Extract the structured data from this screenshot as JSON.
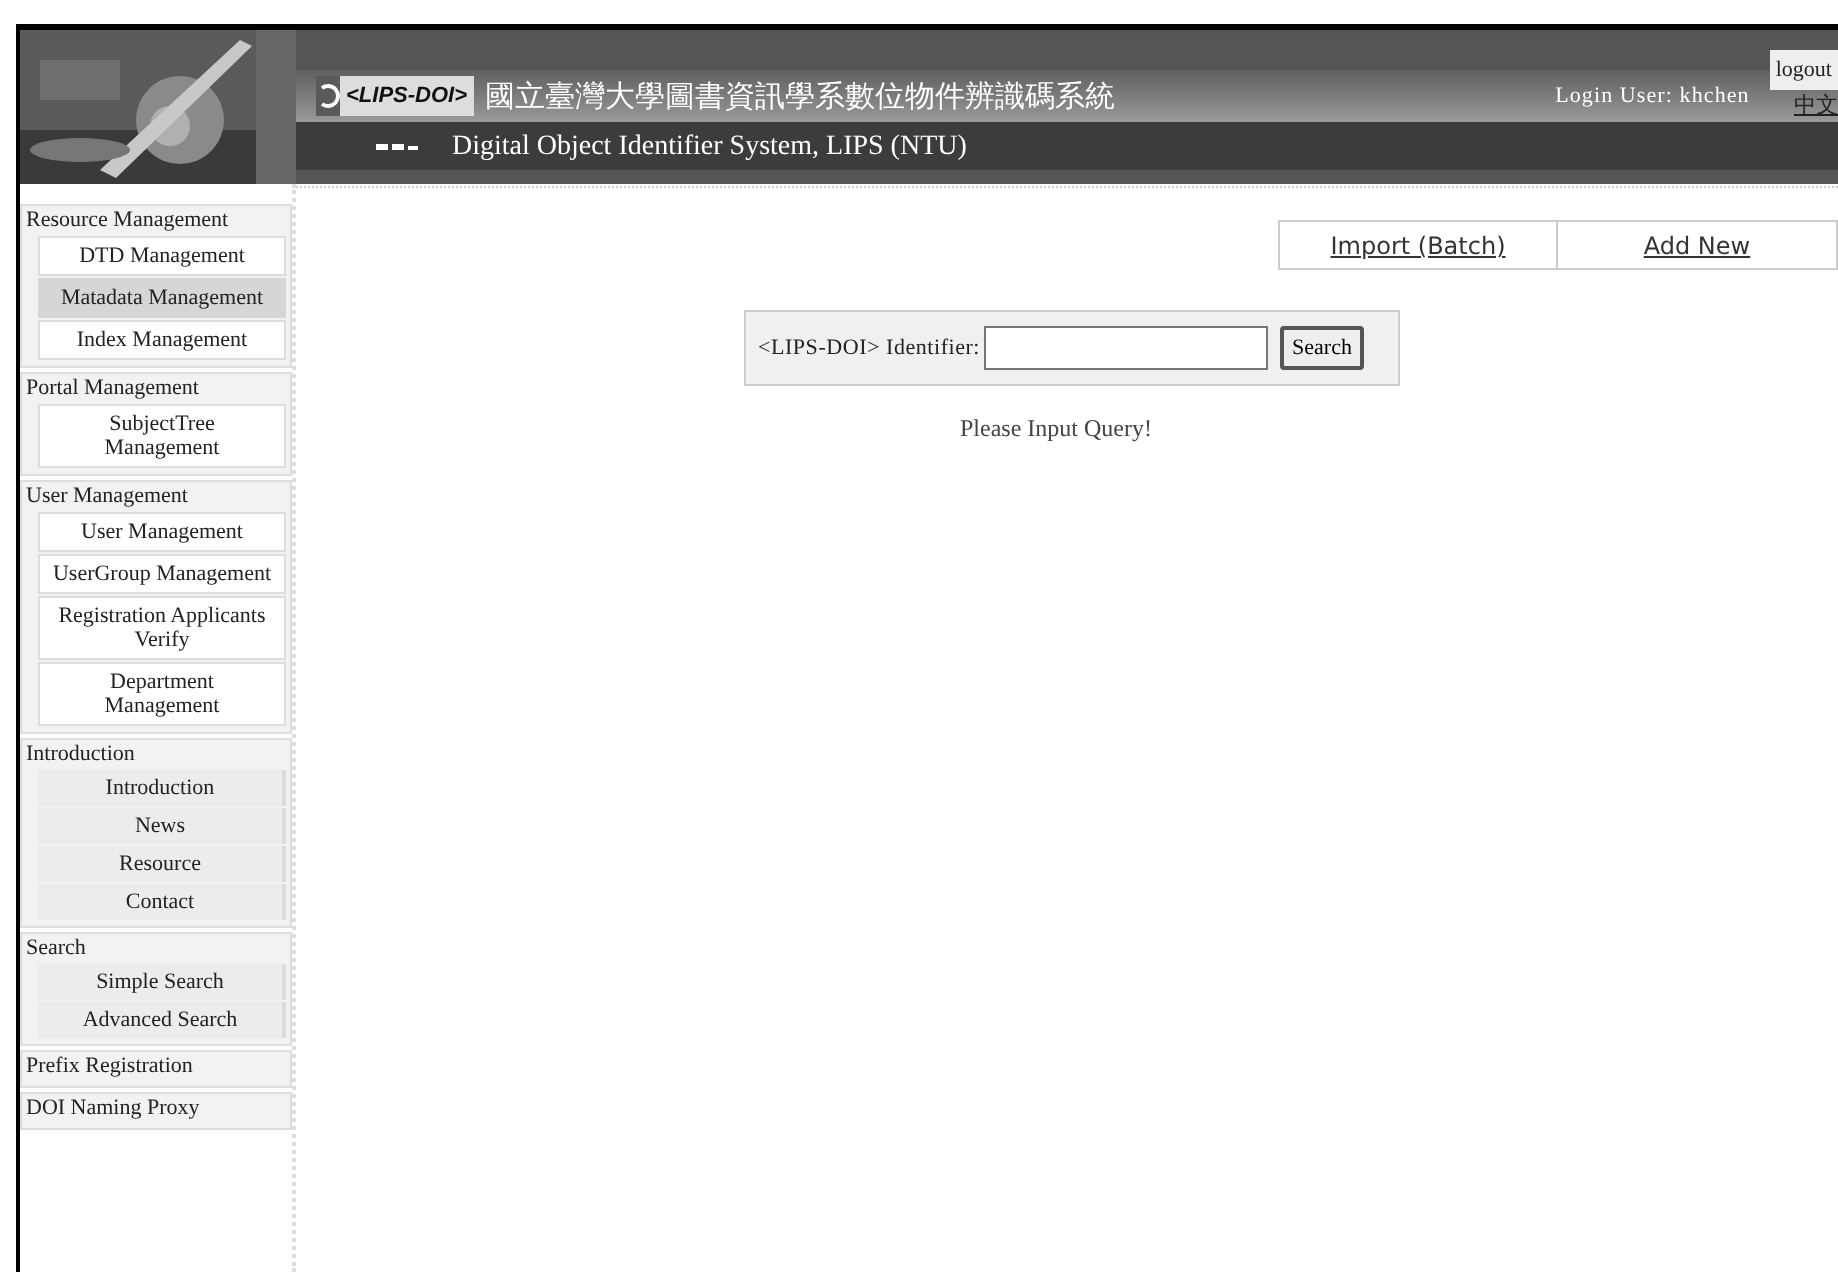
{
  "header": {
    "logo": "<LIPS-DOI>",
    "title_zh": "國立臺灣大學圖書資訊學系數位物件辨識碼系統",
    "title_en": "Digital Object Identifier System, LIPS (NTU)",
    "login_user": "Login User: khchen",
    "logout": "logout",
    "language_link": "中文"
  },
  "sidebar": [
    {
      "title": "Resource Management",
      "kind": "admin",
      "items": [
        {
          "label": "DTD Management",
          "selected": false
        },
        {
          "label": "Matadata Management",
          "selected": true
        },
        {
          "label": "Index Management",
          "selected": false
        }
      ]
    },
    {
      "title": "Portal Management",
      "kind": "admin",
      "items": [
        {
          "label": "SubjectTree Management",
          "selected": false
        }
      ]
    },
    {
      "title": "User Management",
      "kind": "admin",
      "items": [
        {
          "label": "User Management",
          "selected": false
        },
        {
          "label": "UserGroup Management",
          "selected": false
        },
        {
          "label": "Registration Applicants Verify",
          "selected": false
        },
        {
          "label": "Department Management",
          "selected": false
        }
      ]
    },
    {
      "title": "Introduction",
      "kind": "public",
      "items": [
        {
          "label": "Introduction",
          "selected": false
        },
        {
          "label": "News",
          "selected": false
        },
        {
          "label": "Resource",
          "selected": false
        },
        {
          "label": "Contact",
          "selected": false
        }
      ]
    },
    {
      "title": "Search",
      "kind": "public",
      "items": [
        {
          "label": "Simple Search",
          "selected": false
        },
        {
          "label": "Advanced Search",
          "selected": false
        }
      ]
    },
    {
      "title": "Prefix Registration"
    },
    {
      "title": "DOI Naming Proxy"
    }
  ],
  "actions": [
    "Import (Batch)",
    "Add New"
  ],
  "search": {
    "label": "<LIPS-DOI> Identifier:",
    "button": "Search"
  },
  "message": "Please Input Query!"
}
